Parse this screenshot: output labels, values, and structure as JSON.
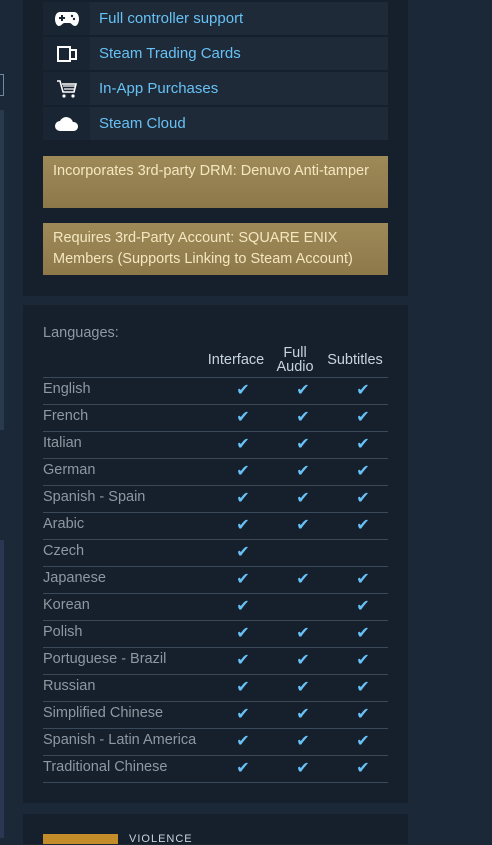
{
  "features": [
    {
      "label": "Full controller support",
      "icon": "gamepad-icon"
    },
    {
      "label": "Steam Trading Cards",
      "icon": "trading-cards-icon"
    },
    {
      "label": "In-App Purchases",
      "icon": "cart-icon"
    },
    {
      "label": "Steam Cloud",
      "icon": "cloud-icon"
    }
  ],
  "notices": [
    "Incorporates 3rd-party DRM: Denuvo Anti-tamper",
    "Requires 3rd-Party Account: SQUARE ENIX Members (Supports Linking to Steam Account)"
  ],
  "languages": {
    "title": "Languages:",
    "columns": {
      "interface": "Interface",
      "full_audio_1": "Full",
      "full_audio_2": "Audio",
      "subtitles": "Subtitles"
    },
    "rows": [
      {
        "name": "English",
        "interface": true,
        "audio": true,
        "subtitles": true
      },
      {
        "name": "French",
        "interface": true,
        "audio": true,
        "subtitles": true
      },
      {
        "name": "Italian",
        "interface": true,
        "audio": true,
        "subtitles": true
      },
      {
        "name": "German",
        "interface": true,
        "audio": true,
        "subtitles": true
      },
      {
        "name": "Spanish - Spain",
        "interface": true,
        "audio": true,
        "subtitles": true
      },
      {
        "name": "Arabic",
        "interface": true,
        "audio": true,
        "subtitles": true
      },
      {
        "name": "Czech",
        "interface": true,
        "audio": false,
        "subtitles": false
      },
      {
        "name": "Japanese",
        "interface": true,
        "audio": true,
        "subtitles": true
      },
      {
        "name": "Korean",
        "interface": true,
        "audio": false,
        "subtitles": true
      },
      {
        "name": "Polish",
        "interface": true,
        "audio": true,
        "subtitles": true
      },
      {
        "name": "Portuguese - Brazil",
        "interface": true,
        "audio": true,
        "subtitles": true
      },
      {
        "name": "Russian",
        "interface": true,
        "audio": true,
        "subtitles": true
      },
      {
        "name": "Simplified Chinese",
        "interface": true,
        "audio": true,
        "subtitles": true
      },
      {
        "name": "Spanish - Latin America",
        "interface": true,
        "audio": true,
        "subtitles": true
      },
      {
        "name": "Traditional Chinese",
        "interface": true,
        "audio": true,
        "subtitles": true
      }
    ]
  },
  "check_glyph": "✔",
  "next_section": {
    "text": "VIOLENCE"
  },
  "colors": {
    "link": "#67c1f5",
    "notice_bg": "#9e8a58",
    "panel_bg": "#16202d",
    "page_bg": "#1b2838"
  }
}
